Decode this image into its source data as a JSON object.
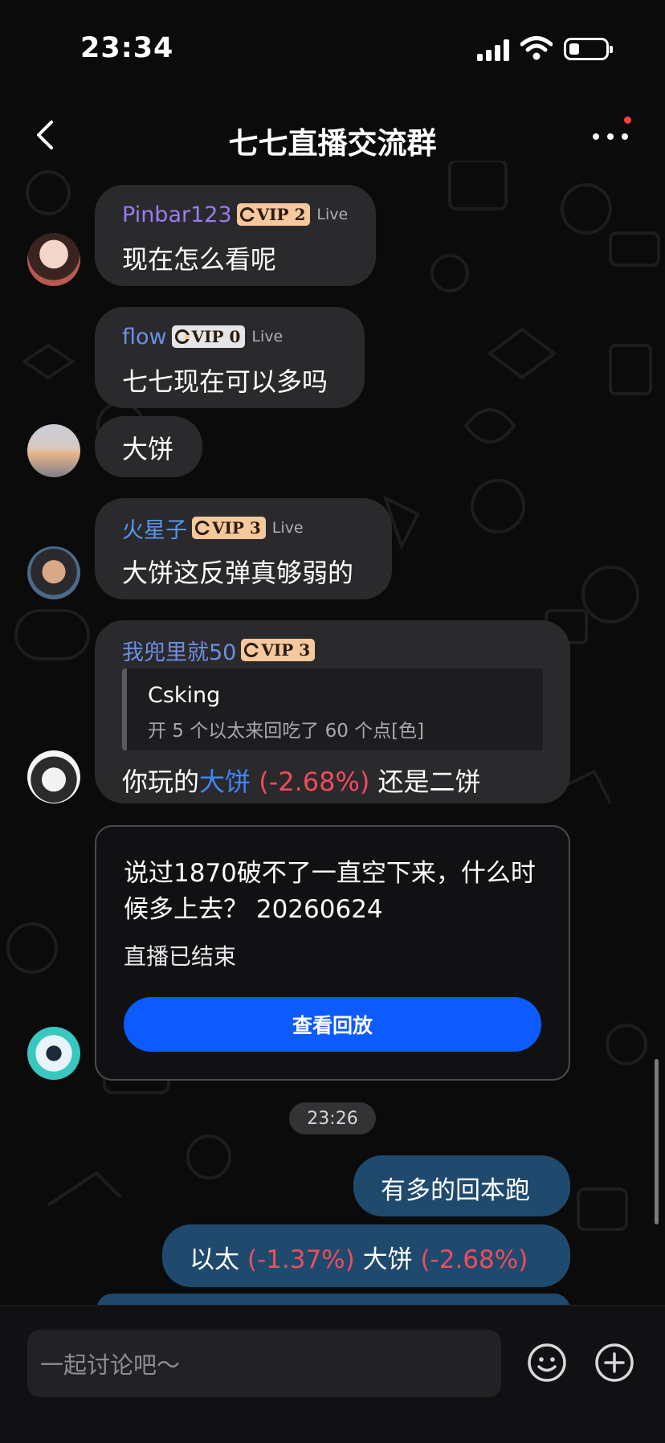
{
  "status_bar": {
    "time": "23:34"
  },
  "header": {
    "title": "七七直播交流群"
  },
  "messages": [
    {
      "sender": "Pinbar123",
      "sender_color": "#9b7cf0",
      "vip": "VIP 2",
      "live": "Live",
      "text": "现在怎么看呢"
    },
    {
      "sender": "flow",
      "sender_color": "#6d8fe6",
      "vip": "VIP 0",
      "live": "Live",
      "text": "七七现在可以多吗"
    },
    {
      "text": "大饼"
    },
    {
      "sender": "火星子",
      "sender_color": "#5a96f0",
      "vip": "VIP 3",
      "live": "Live",
      "text": "大饼这反弹真够弱的"
    },
    {
      "sender": "我兜里就50",
      "sender_color": "#6d8fe6",
      "vip": "VIP 3",
      "quote": {
        "author": "Csking",
        "text": "开 5 个以太来回吃了 60 个点[色]"
      },
      "text_prefix": "你玩的",
      "coin": "大饼",
      "change": "(-2.68%)",
      "text_suffix": "还是二饼"
    }
  ],
  "live_card": {
    "title": "说过1870破不了一直空下来，什么时候多上去？ 20260624",
    "status": "直播已结束",
    "button": "查看回放"
  },
  "time_divider": "23:26",
  "my_messages": [
    {
      "text": "有多的回本跑"
    },
    {
      "coin1": "以太",
      "change1": "(-1.37%)",
      "coin2": "大饼",
      "change2": "(-2.68%)"
    }
  ],
  "input": {
    "placeholder": "一起讨论吧～"
  },
  "colors": {
    "accent_blue": "#0d5bff",
    "loss_red": "#f04b5e",
    "vip_gold": "#f6c89e",
    "my_bubble": "#1f4a6d"
  },
  "icons": [
    "back-icon",
    "more-icon",
    "signal-icon",
    "wifi-icon",
    "battery-icon",
    "emoji-icon",
    "plus-icon"
  ]
}
